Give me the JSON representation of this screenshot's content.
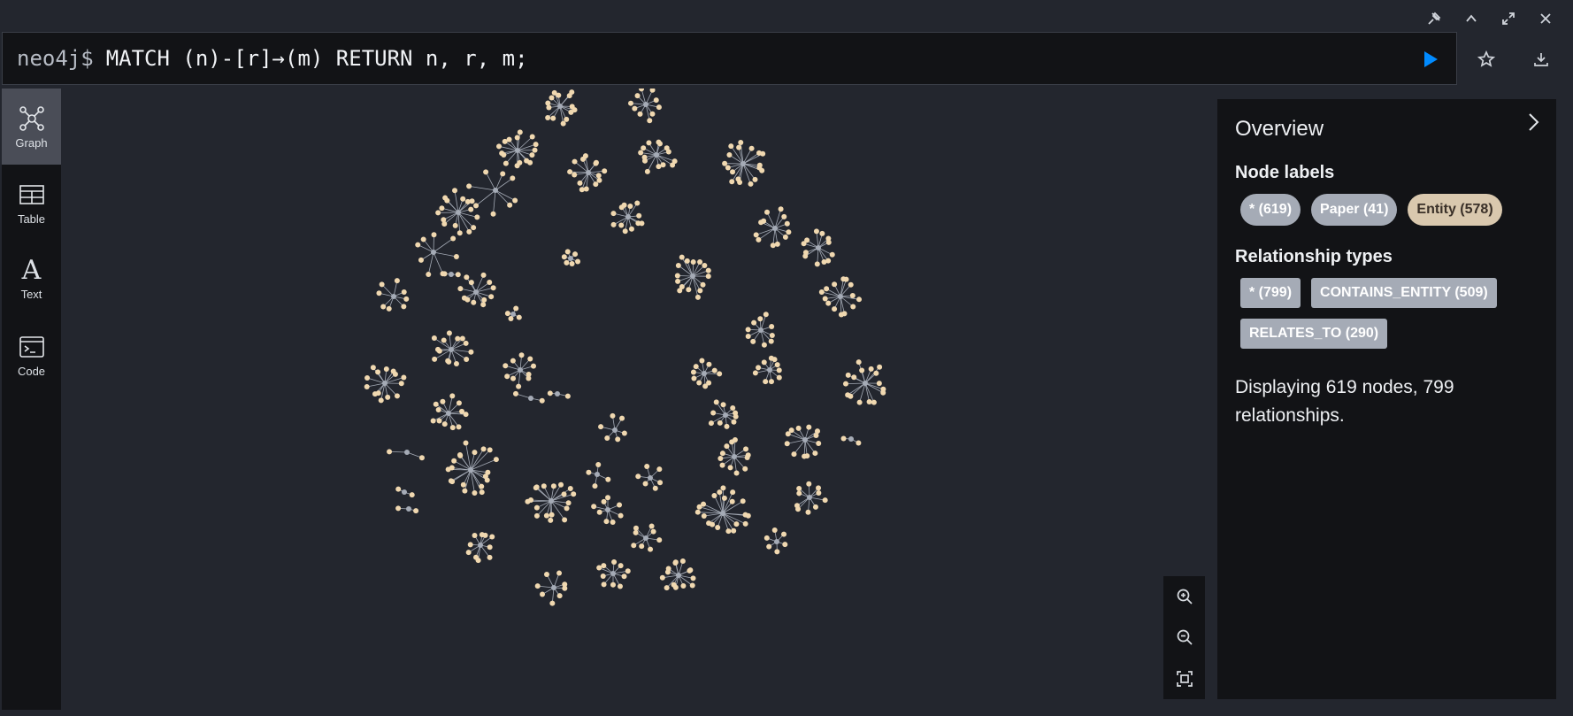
{
  "editor": {
    "prompt": "neo4j$",
    "query": "MATCH (n)-[r]→(m) RETURN n, r, m;"
  },
  "window_controls": [
    "pin-icon",
    "collapse-icon",
    "fullscreen-icon",
    "close-icon"
  ],
  "sidebar": {
    "items": [
      {
        "label": "Graph",
        "icon": "graph-icon",
        "active": true
      },
      {
        "label": "Table",
        "icon": "table-icon",
        "active": false
      },
      {
        "label": "Text",
        "icon": "text-icon",
        "active": false
      },
      {
        "label": "Code",
        "icon": "code-icon",
        "active": false
      }
    ]
  },
  "overview": {
    "title": "Overview",
    "node_labels_heading": "Node labels",
    "node_labels": [
      {
        "text": "* (619)",
        "color": "#a5abb6",
        "text_color": "#ffffff"
      },
      {
        "text": "Paper (41)",
        "color": "#a5abb6",
        "text_color": "#ffffff"
      },
      {
        "text": "Entity (578)",
        "color": "#d9c8ae",
        "text_color": "#3a3028"
      }
    ],
    "relationship_types_heading": "Relationship types",
    "relationship_types": [
      {
        "text": "* (799)"
      },
      {
        "text": "CONTAINS_ENTITY (509)"
      },
      {
        "text": "RELATES_TO (290)"
      }
    ],
    "display_text": "Displaying 619 nodes, 799 relationships."
  },
  "colors": {
    "background": "#23262e",
    "panel": "#121316",
    "run_button": "#018bff",
    "entity_node": "#f0d8b0",
    "paper_node": "#a5abb6",
    "edge": "#a5abb6"
  }
}
